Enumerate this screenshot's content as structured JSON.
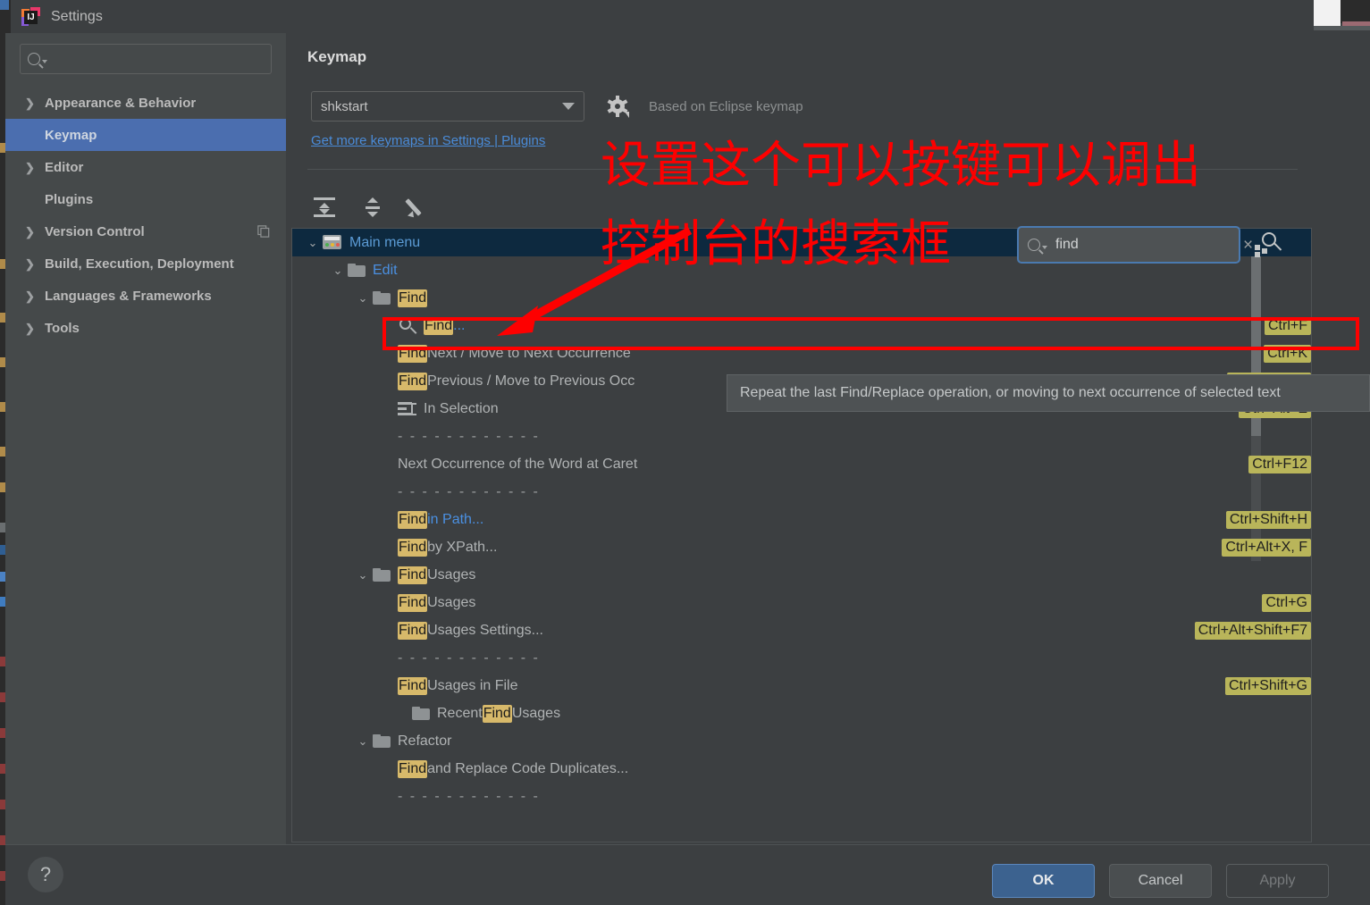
{
  "window": {
    "title": "Settings",
    "app_icon": "intellij-idea-icon"
  },
  "sidebar": {
    "search": {
      "value": "",
      "placeholder": ""
    },
    "items": [
      {
        "label": "Appearance & Behavior",
        "expandable": true,
        "selected": false
      },
      {
        "label": "Keymap",
        "expandable": false,
        "selected": true
      },
      {
        "label": "Editor",
        "expandable": true,
        "selected": false
      },
      {
        "label": "Plugins",
        "expandable": false,
        "selected": false
      },
      {
        "label": "Version Control",
        "expandable": true,
        "selected": false,
        "badge": "copy-icon"
      },
      {
        "label": "Build, Execution, Deployment",
        "expandable": true,
        "selected": false
      },
      {
        "label": "Languages & Frameworks",
        "expandable": true,
        "selected": false
      },
      {
        "label": "Tools",
        "expandable": true,
        "selected": false
      }
    ]
  },
  "main": {
    "title": "Keymap",
    "keymap_select": {
      "value": "shkstart"
    },
    "gear_tooltip": "Keymap settings",
    "based_on": "Based on Eclipse keymap",
    "get_more_link": "Get more keymaps in Settings | Plugins",
    "toolbar": [
      {
        "name": "expand-all-icon",
        "label": "Expand All"
      },
      {
        "name": "collapse-all-icon",
        "label": "Collapse All"
      },
      {
        "name": "edit-shortcut-icon",
        "label": "Edit Shortcut"
      }
    ],
    "tree_search": {
      "value": "find",
      "clear_label": "×"
    },
    "find_shortcut_button": "find-by-shortcut-icon"
  },
  "tree": {
    "rows": [
      {
        "indent": 0,
        "chevron": "v",
        "icon": "main-menu-icon",
        "text": "Main menu",
        "selected": true,
        "shortcut": ""
      },
      {
        "indent": 1,
        "chevron": "v",
        "icon": "folder-icon",
        "text": "Edit",
        "style": "blue",
        "shortcut": ""
      },
      {
        "indent": 2,
        "chevron": "v",
        "icon": "folder-icon",
        "text": "Find",
        "highlight": "Find",
        "rest": "",
        "shortcut": ""
      },
      {
        "indent": 3,
        "chevron": "",
        "icon": "search-icon",
        "text": "Find...",
        "highlight": "Find",
        "rest": "...",
        "rest_style": "blue",
        "shortcut": "Ctrl+F"
      },
      {
        "indent": 3,
        "chevron": "",
        "icon": "",
        "text": "Find Next / Move to Next Occurrence",
        "highlight": "Find",
        "rest": " Next / Move to Next Occurrence",
        "shortcut": "Ctrl+K"
      },
      {
        "indent": 3,
        "chevron": "",
        "icon": "",
        "text": "Find Previous / Move to Previous Occurrence",
        "highlight": "Find",
        "rest": " Previous / Move to Previous Occ",
        "shortcut": "Ctrl+Shift+K"
      },
      {
        "indent": 3,
        "chevron": "",
        "icon": "in-selection-icon",
        "text": "In Selection",
        "shortcut": "Ctrl+Alt+E"
      },
      {
        "indent": 3,
        "chevron": "",
        "icon": "",
        "text": "- - - - - - - - - - - -",
        "separator": true,
        "shortcut": ""
      },
      {
        "indent": 3,
        "chevron": "",
        "icon": "",
        "text": "Next Occurrence of the Word at Caret",
        "shortcut": "Ctrl+F12"
      },
      {
        "indent": 3,
        "chevron": "",
        "icon": "",
        "text": "- - - - - - - - - - - -",
        "separator": true,
        "shortcut": ""
      },
      {
        "indent": 3,
        "chevron": "",
        "icon": "",
        "text": "Find in Path...",
        "highlight": "Find",
        "rest": " in Path...",
        "rest_style": "blue",
        "shortcut": "Ctrl+Shift+H"
      },
      {
        "indent": 3,
        "chevron": "",
        "icon": "",
        "text": "Find by XPath...",
        "highlight": "Find",
        "rest": " by XPath...",
        "shortcut": "Ctrl+Alt+X, F"
      },
      {
        "indent": 2,
        "chevron": "v",
        "icon": "folder-icon",
        "text": "Find Usages",
        "highlight": "Find",
        "rest": " Usages",
        "shortcut": ""
      },
      {
        "indent": 3,
        "chevron": "",
        "icon": "",
        "text": "Find Usages",
        "highlight": "Find",
        "rest": " Usages",
        "shortcut": "Ctrl+G"
      },
      {
        "indent": 3,
        "chevron": "",
        "icon": "",
        "text": "Find Usages Settings...",
        "highlight": "Find",
        "rest": " Usages Settings...",
        "shortcut": "Ctrl+Alt+Shift+F7"
      },
      {
        "indent": 3,
        "chevron": "",
        "icon": "",
        "text": "- - - - - - - - - - - -",
        "separator": true,
        "shortcut": ""
      },
      {
        "indent": 3,
        "chevron": "",
        "icon": "",
        "text": "Find Usages in File",
        "highlight": "Find",
        "rest": " Usages in File",
        "shortcut": "Ctrl+Shift+G"
      },
      {
        "indent": 3,
        "chevron": "",
        "icon": "folder-icon",
        "text": "Recent Find Usages",
        "pre": "Recent ",
        "highlight": "Find",
        "rest": " Usages",
        "shortcut": ""
      },
      {
        "indent": 1,
        "chevron": "v",
        "icon": "folder-icon",
        "text": "Refactor",
        "shortcut": ""
      },
      {
        "indent": 2,
        "chevron": "",
        "icon": "",
        "text": "Find and Replace Code Duplicates...",
        "highlight": "Find",
        "rest": " and Replace Code Duplicates...",
        "shortcut": ""
      },
      {
        "indent": 2,
        "chevron": "",
        "icon": "",
        "text": "- - - - - - - - - - - -",
        "separator": true,
        "shortcut": ""
      }
    ]
  },
  "tooltip": {
    "text": "Repeat the last Find/Replace operation, or moving to next occurrence of selected text"
  },
  "annotations": {
    "line1": "设置这个可以按键可以调出",
    "line2": "控制台的搜索框",
    "color": "#fe0000"
  },
  "footer": {
    "help_label": "?",
    "ok_label": "OK",
    "cancel_label": "Cancel",
    "apply_label": "Apply"
  }
}
